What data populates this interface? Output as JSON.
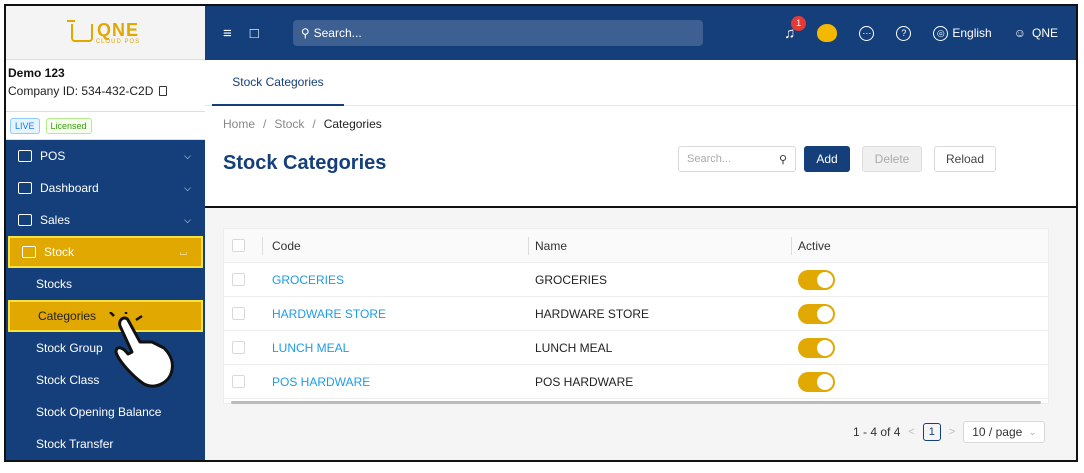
{
  "app": {
    "logo_brand": "QNE",
    "logo_sub": "CLOUD POS"
  },
  "company": {
    "name": "Demo 123",
    "id_label": "Company ID: 534-432-C2D",
    "badge_live": "LIVE",
    "badge_licensed": "Licensed"
  },
  "sidebar": {
    "items": [
      {
        "label": "POS",
        "icon": "pos-icon"
      },
      {
        "label": "Dashboard",
        "icon": "dashboard-icon"
      },
      {
        "label": "Sales",
        "icon": "cart-icon"
      },
      {
        "label": "Stock",
        "icon": "box-icon"
      }
    ],
    "stock_sub": [
      "Stocks",
      "Categories",
      "Stock Group",
      "Stock Class",
      "Stock Opening Balance",
      "Stock Transfer"
    ]
  },
  "topbar": {
    "search_placeholder": "Search...",
    "notification_count": "1",
    "language": "English",
    "user": "QNE"
  },
  "main": {
    "tab": "Stock Categories",
    "breadcrumb": [
      "Home",
      "/",
      "Stock",
      "/",
      "Categories"
    ],
    "title": "Stock Categories",
    "search_placeholder": "Search...",
    "add_label": "Add",
    "delete_label": "Delete",
    "reload_label": "Reload"
  },
  "table": {
    "headers": [
      "Code",
      "Name",
      "Active"
    ],
    "rows": [
      {
        "code": "GROCERIES",
        "name": "GROCERIES",
        "active": true
      },
      {
        "code": "HARDWARE STORE",
        "name": "HARDWARE STORE",
        "active": true
      },
      {
        "code": "LUNCH MEAL",
        "name": "LUNCH MEAL",
        "active": true
      },
      {
        "code": "POS HARDWARE",
        "name": "POS HARDWARE",
        "active": true
      }
    ]
  },
  "pager": {
    "range": "1 - 4 of 4",
    "page": "1",
    "page_size": "10 / page"
  },
  "colors": {
    "primary": "#153f7a",
    "accent": "#e0a800",
    "link": "#1e9be8"
  }
}
